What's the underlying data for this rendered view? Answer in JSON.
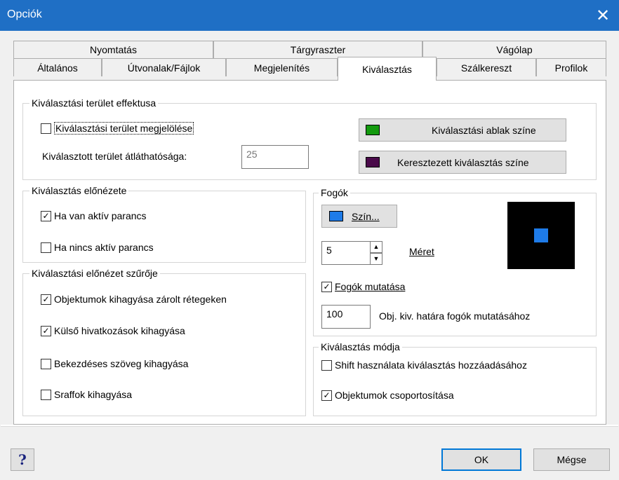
{
  "window": {
    "title": "Opciók"
  },
  "tabs_row1": [
    "Nyomtatás",
    "Tárgyraszter",
    "Vágólap"
  ],
  "tabs_row2": [
    "Általános",
    "Útvonalak/Fájlok",
    "Megjelenítés",
    "Kiválasztás",
    "Szálkereszt",
    "Profilok"
  ],
  "active_tab": "Kiválasztás",
  "area_effect": {
    "title": "Kiválasztási terület effektusa",
    "show_area": {
      "label": "Kiválasztási terület megjelölése",
      "checked": false
    },
    "transparency_label": "Kiválasztott terület átláthatósága:",
    "transparency_value": "25",
    "window_color_button": "Kiválasztási ablak színe",
    "window_color": "#139a0e",
    "crossing_color_button": "Keresztezett kiválasztás színe",
    "crossing_color": "#4a0a4a"
  },
  "preview": {
    "title": "Kiválasztás előnézete",
    "active_cmd": {
      "label": "Ha van aktív parancs",
      "checked": true
    },
    "no_cmd": {
      "label": "Ha nincs aktív parancs",
      "checked": false
    }
  },
  "filter": {
    "title": "Kiválasztási előnézet szűrője",
    "items": [
      {
        "label": "Objektumok kihagyása zárolt rétegeken",
        "checked": true
      },
      {
        "label": "Külső hivatkozások kihagyása",
        "checked": true
      },
      {
        "label": "Bekezdéses szöveg kihagyása",
        "checked": false
      },
      {
        "label": "Sraffok kihagyása",
        "checked": false
      }
    ]
  },
  "grips": {
    "title": "Fogók",
    "color_button": "Szín...",
    "color": "#1e7be8",
    "size_value": "5",
    "size_label": "Méret",
    "show_grips": {
      "label": "Fogók mutatása",
      "checked": true
    },
    "limit_value": "100",
    "limit_label": "Obj. kiv. határa fogók mutatásához"
  },
  "mode": {
    "title": "Kiválasztás módja",
    "shift": {
      "label": "Shift használata kiválasztás hozzáadásához",
      "checked": false
    },
    "group": {
      "label": "Objektumok csoportosítása",
      "checked": true
    }
  },
  "footer": {
    "help": "?",
    "ok": "OK",
    "cancel": "Mégse"
  }
}
